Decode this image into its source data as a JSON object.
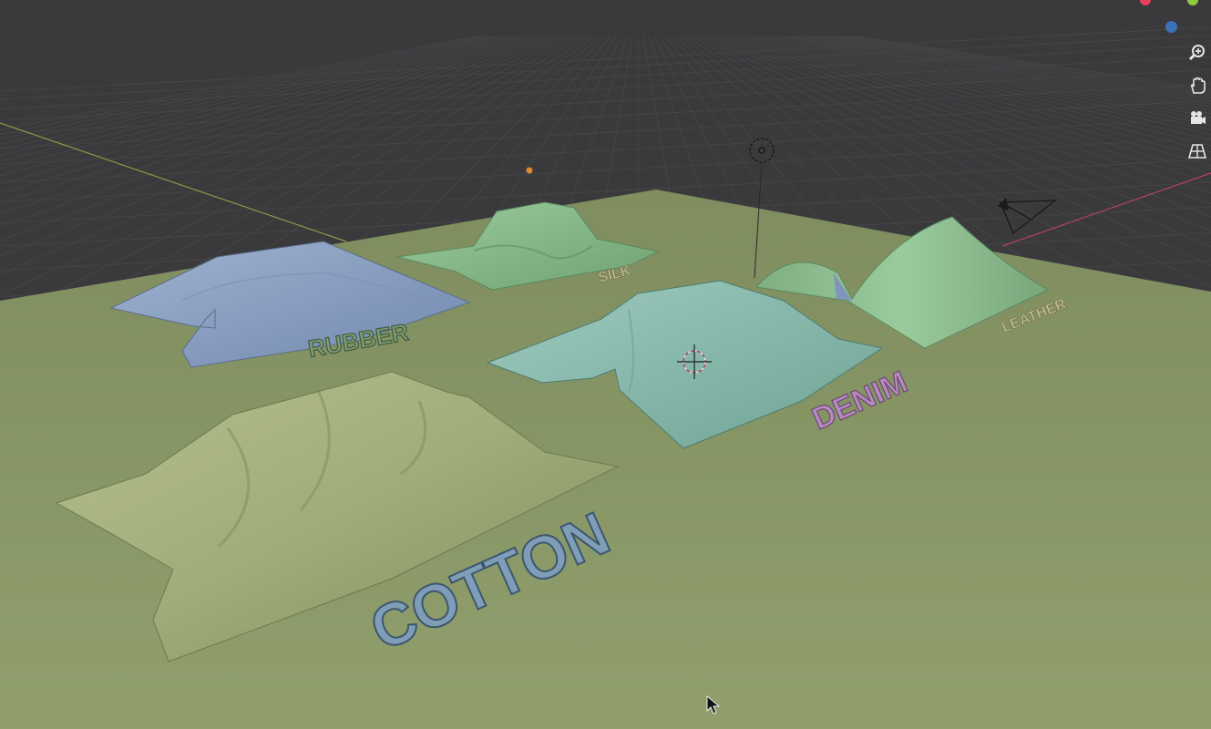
{
  "app": {
    "name": "3D viewport"
  },
  "objects": [
    {
      "name": "rubber-cloth",
      "label": "RUBBER",
      "cloth_color": "#8fa3c4",
      "text_color": "#7e9c76"
    },
    {
      "name": "silk-cloth",
      "label": "SILK",
      "cloth_color": "#88b38b",
      "text_color": "#c9c59a"
    },
    {
      "name": "leather-cloth",
      "label": "LEATHER",
      "cloth_color": "#8cb88e",
      "text_color": "#c9c59a"
    },
    {
      "name": "denim-cloth",
      "label": "DENIM",
      "cloth_color": "#8cbcb1",
      "text_color": "#b889bf"
    },
    {
      "name": "cotton-cloth",
      "label": "COTTON",
      "cloth_color": "#a4b07e",
      "text_color": "#7f9db7"
    }
  ],
  "navigation": {
    "tools": [
      {
        "id": "zoom",
        "icon": "zoom-in-icon"
      },
      {
        "id": "pan",
        "icon": "hand-icon"
      },
      {
        "id": "camera",
        "icon": "camera-icon"
      },
      {
        "id": "perspective",
        "icon": "grid-perspective-icon"
      }
    ],
    "gizmo_colors": {
      "x": "#e5405e",
      "y": "#8ccc3e",
      "z": "#3d71b8"
    }
  },
  "colors": {
    "background": "#3a3a3d",
    "ground": "#8a9a68",
    "grid_line": "#474749",
    "x_axis": "#b5445a",
    "y_axis": "#8d9a42",
    "light": "#1a1a1a",
    "origin": "#e0892c"
  }
}
